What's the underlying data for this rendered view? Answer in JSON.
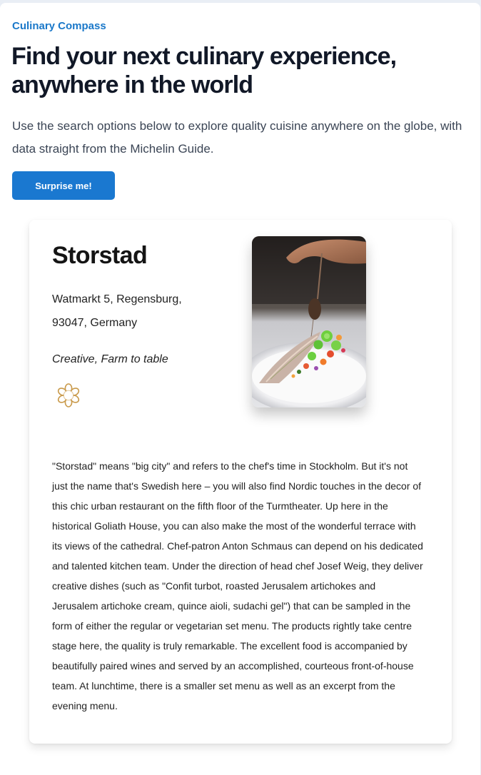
{
  "brand": "Culinary Compass",
  "headline": "Find your next culinary experience, anywhere in the world",
  "intro": "Use the search options below to explore quality cuisine anywhere on the globe, with data straight from the Michelin Guide.",
  "cta_label": "Surprise me!",
  "restaurant": {
    "name": "Storstad",
    "address": "Watmarkt 5, Regensburg, 93047, Germany",
    "cuisine": "Creative, Farm to table",
    "award_icon": "michelin-star-icon",
    "award_color": "#c99a4b",
    "description": "\"Storstad\" means \"big city\" and refers to the chef's time in Stockholm. But it's not just the name that's Swedish here – you will also find Nordic touches in the decor of this chic urban restaurant on the fifth floor of the Turmtheater. Up here in the historical Goliath House, you can also make the most of the wonderful terrace with its views of the cathedral. Chef-patron Anton Schmaus can depend on his dedicated and talented kitchen team. Under the direction of head chef Josef Weig, they deliver creative dishes (such as \"Confit turbot, roasted Jerusalem artichokes and Jerusalem artichoke cream, quince aioli, sudachi gel\") that can be sampled in the form of either the regular or vegetarian set menu. The products rightly take centre stage here, the quality is truly remarkable. The excellent food is accompanied by beautifully paired wines and served by an accomplished, courteous front-of-house team. At lunchtime, there is a smaller set menu as well as an excerpt from the evening menu."
  },
  "colors": {
    "accent": "#1a78d0",
    "brand_text": "#1a78c9"
  }
}
